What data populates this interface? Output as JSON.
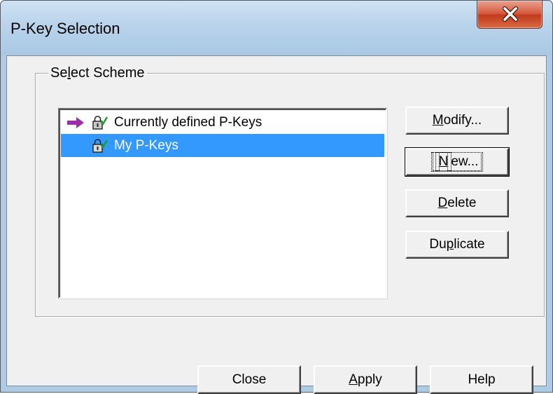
{
  "window": {
    "title": "P-Key Selection",
    "close_button_icon": "close-x-icon"
  },
  "group": {
    "label": "Select Scheme"
  },
  "list": {
    "items": [
      {
        "label": "Currently defined P-Keys",
        "current": true,
        "selected": false,
        "icons": [
          "arrow-right-icon",
          "locked-key-icon"
        ]
      },
      {
        "label": "My P-Keys",
        "current": false,
        "selected": true,
        "icons": [
          "locked-key-icon"
        ]
      }
    ]
  },
  "buttons": {
    "modify": {
      "pre": "",
      "key": "M",
      "post": "odify..."
    },
    "new": {
      "pre": "",
      "key": "N",
      "post": "ew..."
    },
    "delete": {
      "pre": "",
      "key": "D",
      "post": "elete"
    },
    "duplicate": {
      "pre": "Du",
      "key": "p",
      "post": "licate"
    },
    "close": {
      "label": "Close"
    },
    "apply": {
      "pre": "",
      "key": "A",
      "post": "pply"
    },
    "help": {
      "label": "Help"
    }
  },
  "colors": {
    "selection": "#3399ff",
    "arrow": "#9b2fa8",
    "title_bar": "#b9d3ea",
    "close_button": "#d4573c",
    "dialog_face": "#f0f0f0"
  }
}
